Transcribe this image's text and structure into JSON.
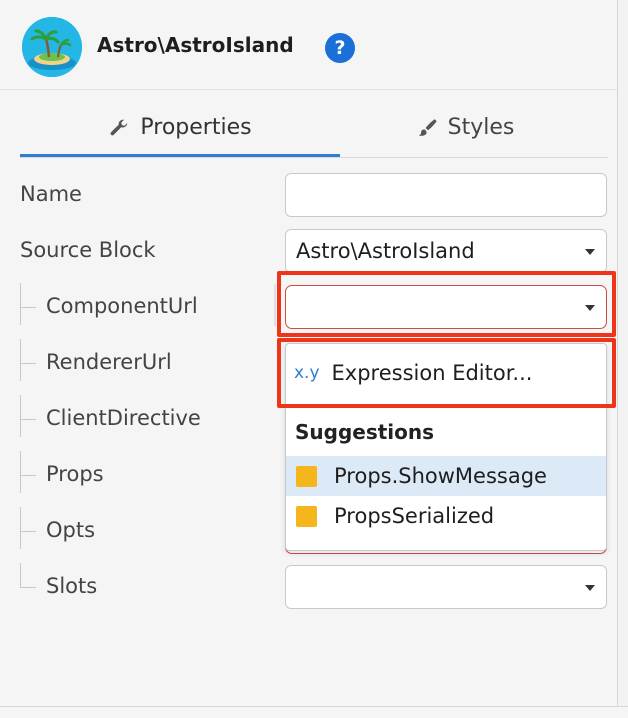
{
  "header": {
    "title": "Astro\\AstroIsland",
    "help_label": "?"
  },
  "tabs": [
    {
      "label": "Properties",
      "icon": "wrench-icon",
      "active": true
    },
    {
      "label": "Styles",
      "icon": "brush-icon",
      "active": false
    }
  ],
  "fields": {
    "name": {
      "label": "Name",
      "value": ""
    },
    "source_block": {
      "label": "Source Block",
      "value": "Astro\\AstroIsland"
    },
    "component_url": {
      "label": "ComponentUrl",
      "value": ""
    },
    "renderer_url": {
      "label": "RendererUrl"
    },
    "client_directive": {
      "label": "ClientDirective"
    },
    "props": {
      "label": "Props"
    },
    "opts": {
      "label": "Opts"
    },
    "slots": {
      "label": "Slots",
      "value": ""
    }
  },
  "dropdown": {
    "expression_icon": "x.y",
    "expression_label": "Expression Editor...",
    "suggestions_heading": "Suggestions",
    "suggestions": [
      {
        "label": "Props.ShowMessage",
        "selected": true
      },
      {
        "label": "PropsSerialized",
        "selected": false
      }
    ]
  },
  "colors": {
    "accent": "#2e7fd1",
    "highlight": "#f0341a",
    "suggestion_square": "#f5b51c",
    "selected_row": "#dce9f7"
  }
}
